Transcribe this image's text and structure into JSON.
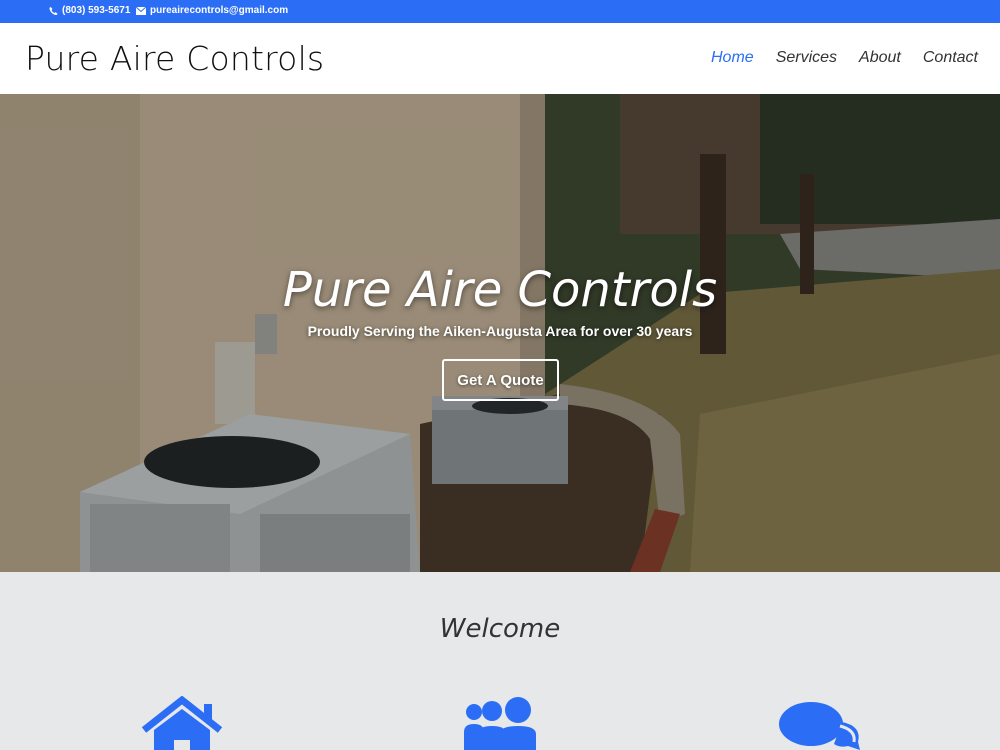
{
  "topbar": {
    "phone": "(803) 593-5671",
    "email": "pureairecontrols@gmail.com",
    "phone_icon": "phone-icon",
    "email_icon": "envelope-icon"
  },
  "header": {
    "logo": "Pure Aire Controls",
    "nav": [
      {
        "label": "Home",
        "active": true
      },
      {
        "label": "Services",
        "active": false
      },
      {
        "label": "About",
        "active": false
      },
      {
        "label": "Contact",
        "active": false
      }
    ]
  },
  "hero": {
    "title": "Pure Aire Controls",
    "subtitle": "Proudly Serving the Aiken-Augusta Area for over 30 years",
    "button": "Get A Quote"
  },
  "welcome": {
    "title": "Welcome",
    "icons": [
      "home-icon",
      "users-icon",
      "chat-icon"
    ]
  },
  "colors": {
    "accent": "#2b6ef5",
    "welcome_bg": "#e6e8ea"
  }
}
